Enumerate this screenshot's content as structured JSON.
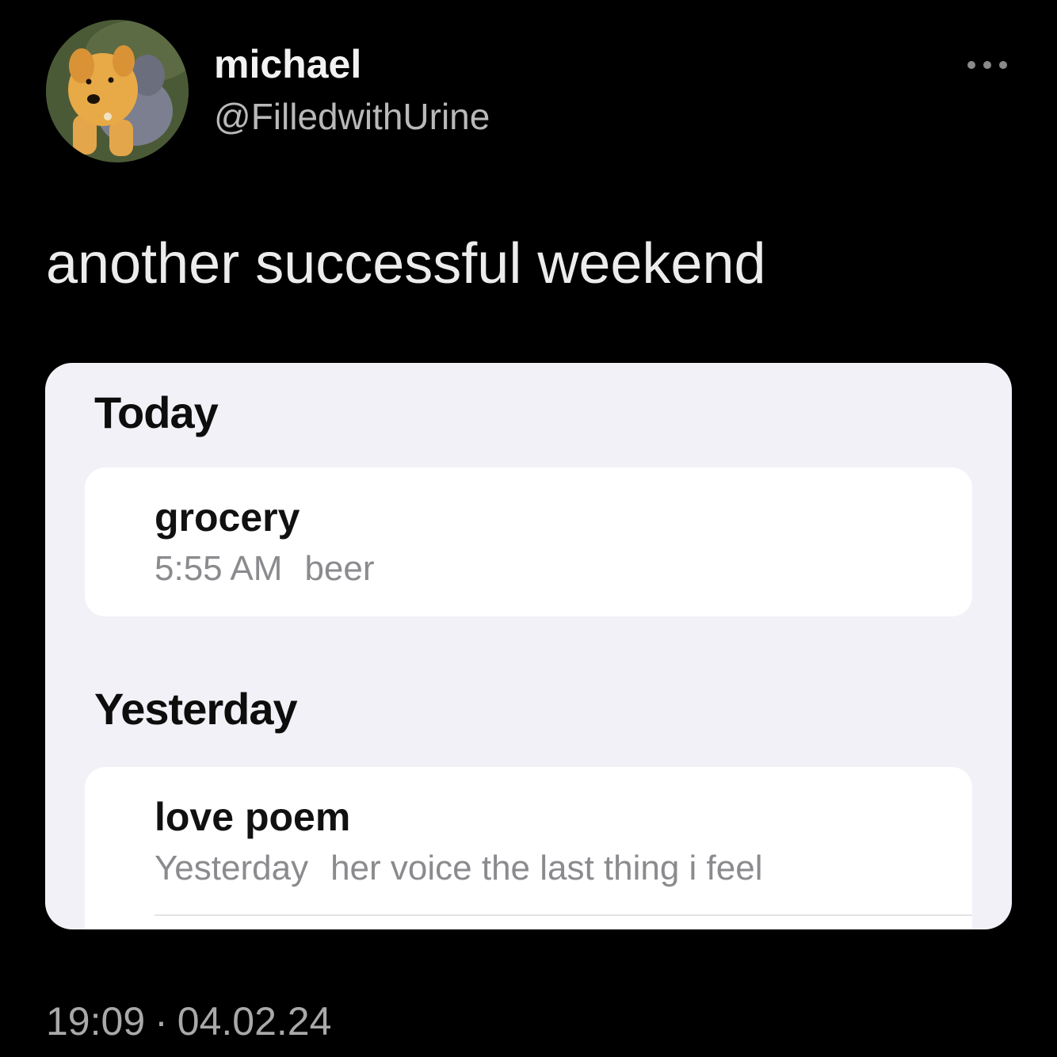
{
  "tweet": {
    "author": {
      "display_name": "michael",
      "handle": "@FilledwithUrine",
      "avatar_icon": "plush-dog-avatar"
    },
    "more_icon": "more-dots-icon",
    "text": "another successful weekend",
    "time": "19:09",
    "separator": "·",
    "date": "04.02.24"
  },
  "notes_screenshot": {
    "sections": [
      {
        "header": "Today",
        "notes": [
          {
            "title": "grocery",
            "date": "5:55 AM",
            "preview": "beer"
          }
        ]
      },
      {
        "header": "Yesterday",
        "notes": [
          {
            "title": "love poem",
            "date": "Yesterday",
            "preview": "her voice the last thing i feel"
          }
        ]
      }
    ]
  },
  "colors": {
    "background": "#000000",
    "card_background": "#f2f1f7",
    "note_background": "#ffffff",
    "secondary_text": "#8b8b8f"
  }
}
